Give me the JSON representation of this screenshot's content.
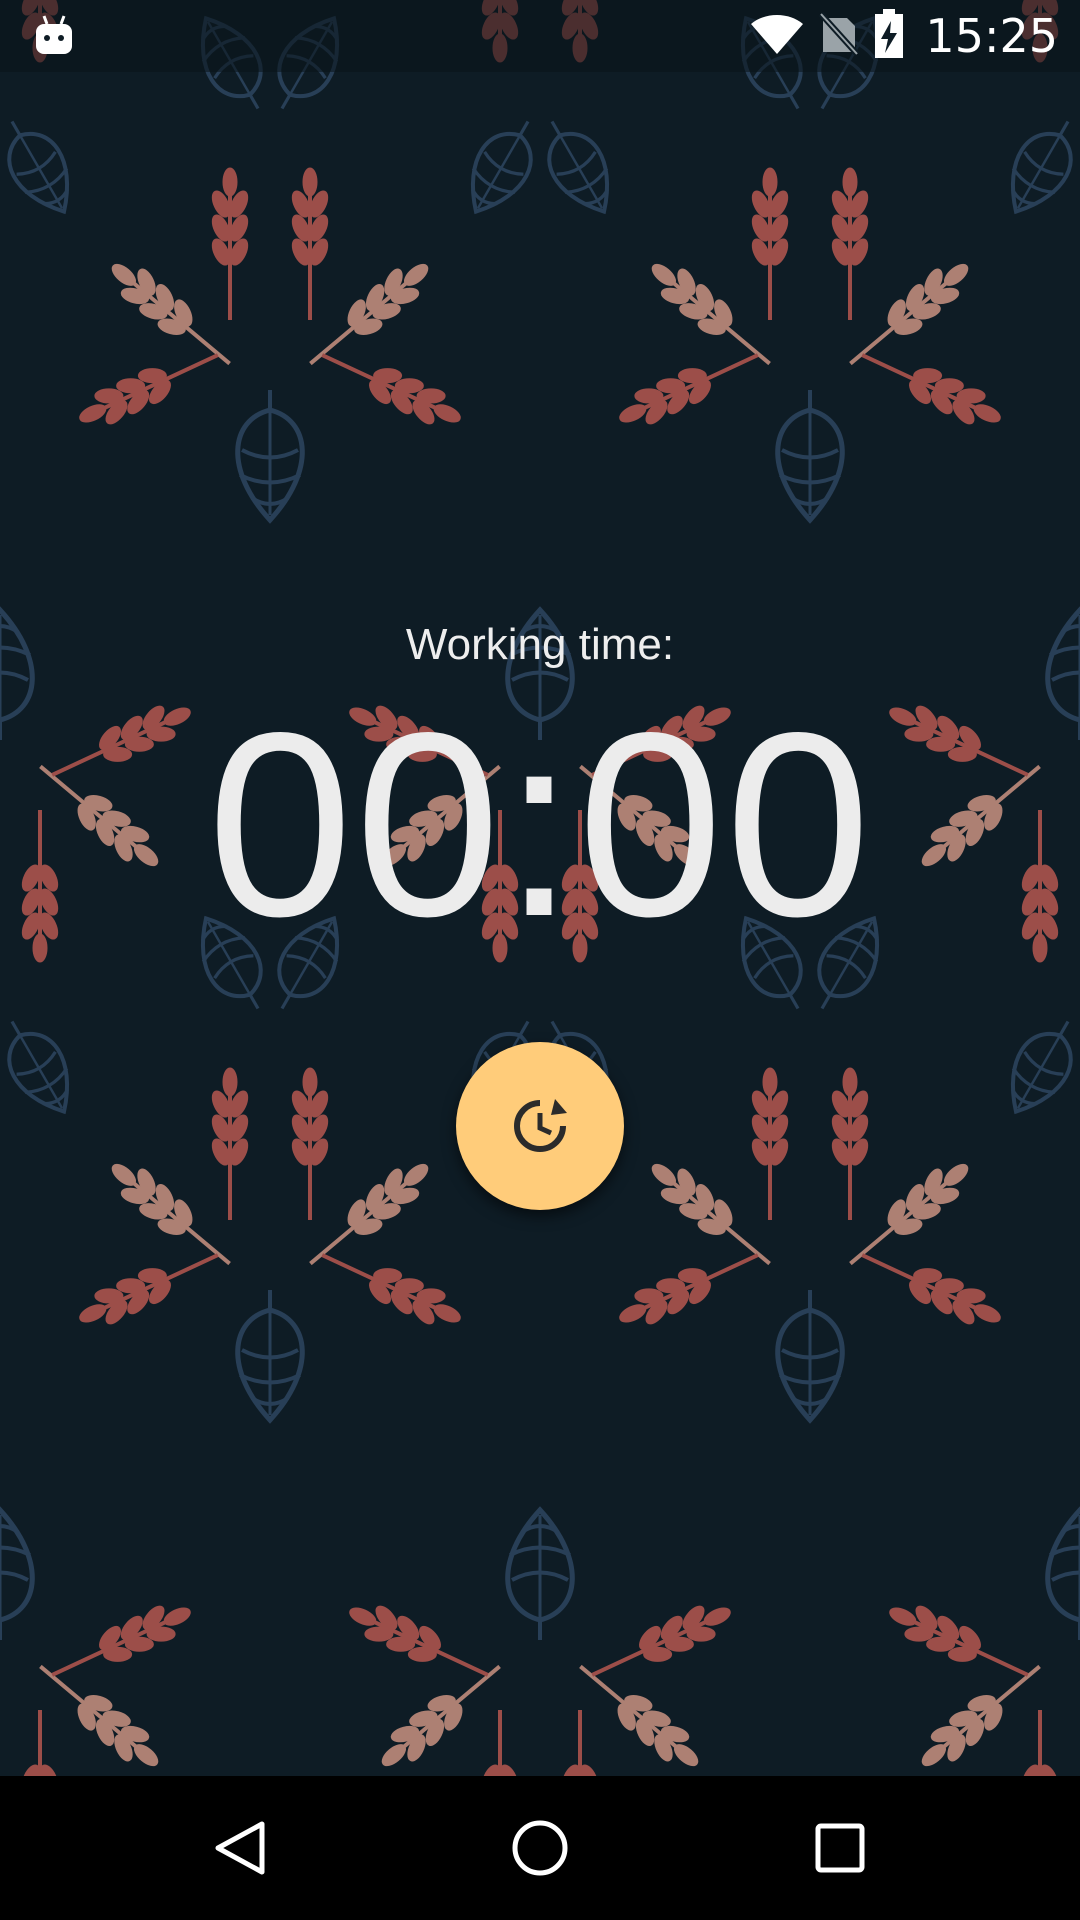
{
  "status_bar": {
    "time": "15:25",
    "left_icon": "android-debug-icon",
    "icons": [
      "wifi-icon",
      "no-sim-icon",
      "battery-charging-icon"
    ]
  },
  "timer": {
    "label": "Working time:",
    "value": "00:00",
    "reset_icon": "timer-restart-icon"
  },
  "nav_bar": {
    "buttons": [
      "back-icon",
      "home-icon",
      "recents-icon"
    ]
  },
  "colors": {
    "background": "#0e1c25",
    "fab": "#ffcc7a",
    "text": "#ececec",
    "wheat_red": "#b5574f",
    "wheat_tan": "#c99281",
    "hop_blue": "#2c4560"
  }
}
